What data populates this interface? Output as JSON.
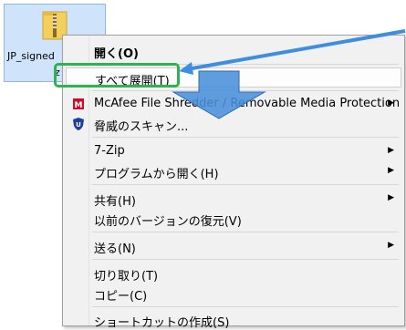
{
  "file": {
    "name_line1": "JP_signed",
    "name_line2": "z",
    "icon": "zip-folder-icon"
  },
  "menu": {
    "open": "開く(O)",
    "extract_all": "すべて展開(T)",
    "mcafee": "McAfee File Shredder / Removable Media Protection",
    "scan": "脅威のスキャン...",
    "zip7": "7-Zip",
    "open_with": "プログラムから開く(H)",
    "share": "共有(H)",
    "restore": "以前のバージョンの復元(V)",
    "send_to": "送る(N)",
    "cut": "切り取り(T)",
    "copy": "コピー(C)",
    "shortcut": "ショートカットの作成(S)"
  },
  "colors": {
    "highlight_box": "#2eb352",
    "arrow_fill": "#4a90d9",
    "pointer_line": "#3d8ee0"
  },
  "annotations": {
    "arrow": "down-arrow-icon",
    "pointer": "pointer-line"
  }
}
